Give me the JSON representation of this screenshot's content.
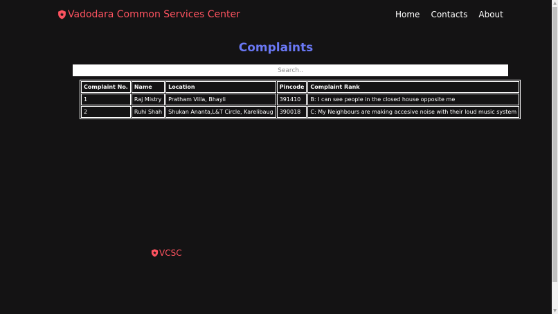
{
  "header": {
    "brand_name": "Vadodara Common Services Center",
    "nav": [
      {
        "label": "Home"
      },
      {
        "label": "Contacts"
      },
      {
        "label": "About"
      }
    ]
  },
  "main": {
    "title": "Complaints",
    "search_placeholder": "Search..",
    "table": {
      "columns": [
        "Complaint No.",
        "Name",
        "Location",
        "Pincode",
        "Complaint Rank"
      ],
      "rows": [
        [
          "1",
          "Raj Mistry",
          "Pratham Villa, Bhayli",
          "391410",
          "B: I can see people in the closed house opposite me"
        ],
        [
          "2",
          "Ruhi Shah",
          "Shukan Ananta,L&T Circle, Karelibaug",
          "390018",
          "C: My Neighbours are making accesive noise with their loud music system"
        ]
      ]
    }
  },
  "footer": {
    "brand_short": "VCSC"
  },
  "icons": {
    "brand": "shield-icon",
    "footer_brand": "shield-icon",
    "scroll_up": "arrow-up-icon",
    "scroll_down": "arrow-down-icon"
  },
  "colors": {
    "background": "#141314",
    "brand": "#ff5360",
    "title": "#6a78f5",
    "text": "#ffffff"
  }
}
